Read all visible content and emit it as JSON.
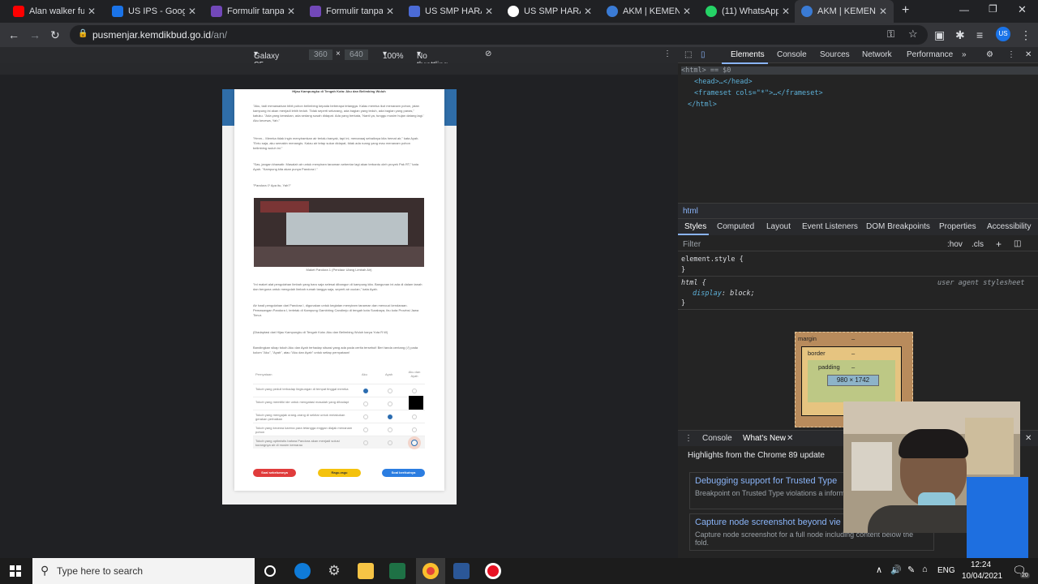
{
  "tabs": [
    {
      "title": "Alan walker full a",
      "color": "#ff0000"
    },
    {
      "title": "US IPS - Google",
      "color": "#1a73e8"
    },
    {
      "title": "Formulir tanpa ju",
      "color": "#7248b9"
    },
    {
      "title": "Formulir tanpa ju",
      "color": "#7248b9"
    },
    {
      "title": "US SMP HARAPA",
      "color": "#4b6bd6"
    },
    {
      "title": "US SMP HARAPA",
      "color": "#ffffff"
    },
    {
      "title": "AKM | KEMENTE",
      "color": "#3a7bd5"
    },
    {
      "title": "(11) WhatsApp",
      "color": "#25d366"
    },
    {
      "title": "AKM | KEMENTE",
      "color": "#3a7bd5"
    }
  ],
  "address": {
    "host": "pusmenjar.kemdikbud.go.id",
    "path": "/an/"
  },
  "device_toolbar": {
    "device": "Galaxy S5",
    "width": "360",
    "height": "640",
    "times": "×",
    "zoom": "100%",
    "throttle": "No throttling"
  },
  "device_page": {
    "title": "Hijau Kampungku di Tengah Kota: Aku dan Belimbing Wuluh",
    "paragraphs": [
      "\"Aku, tadi menawarkan bibit pohon belimbing kepada beberapa tetangga. Kalau mereka ikut menanam pohon, jalan kampung ini akan menjadi lebih teduh. Tidak seperti sekarang, ada bagian yang teduh, ada bagian yang panas,\" katuku. \"Ada yang keraskan, ada sedang susah didapat. Ada yang berkata, 'Nanti ya, tunggu musim hujan datang lagi.' Aku kecewa, Yah.\"",
      "\"Hmm... Mereka tidak ingin menyiramkan air terlalu banyak, tapi ini, menanaaj sebaiknya kita hemat air,\" kata Ayah. \"Entu saja, aku semakin menangis. Kalau air tetap sukar didapat, tidak ada ruang yang mau menanam pohon belimbing wuluh ini.\"",
      "\"Sas, jangan khawatir. Masalah air untuk menyiram tanaman sebentar lagi akan terbantu oleh proyek Pak RT,\" kata Ayah. \"Kampung kita akan punya Pandora I.\"",
      "\"Pandora I? Apa itu, Yah?\""
    ],
    "photo_caption": "Maket Pandora 1 (Pendaur Ulang Limbah Air)",
    "paragraphs2": [
      "\"Ini maket alat pengolahan limbah yang baru saja selesai dibangun di kampung kita. Bangunan ini ada di dalam tanah dan berguna untuk mengolah limbah rumah tangga saja, seperti air cucian,\" kata Ayah.",
      "Air hasil pengolahan dari Pandora I, digunakan untuk kegiatan menyiram tanaman dan mencuci kendaraan. Pemasangan Pandora I, terletak di Kampung Gambiring Candirejo di tengah kota Surabaya, ibu kota Provinsi Jawa Timur.",
      "(Diadaptasi dari Hijau Kampungku di Tengah Kota: Aku dan Belimbing Wuluh karya Yuta R.W)",
      "Bandingkan sikap tokoh Aku dan Ayah terhadap situasi yang ada pada cerita tersebut! Beri tanda centang (√) pada kolom \"Aku\", \"Ayah\", atau \"Aku dan Ayah\" untuk setiap pernyataan!"
    ],
    "table": {
      "headers": [
        "Pernyataan",
        "Aku",
        "Ayah",
        "Aku dan Ayah"
      ],
      "rows": [
        {
          "text": "Tokoh yang peduli terhadap lingkungan di tempat tinggal mereka",
          "sel": 0
        },
        {
          "text": "Tokoh yang memiliki ide untuk mengatasi masalah yang dihadapi",
          "sel": -1
        },
        {
          "text": "Tokoh yang mengajak orang-orang di sekitar untuk melakukan gerakan perbaikan",
          "sel": 1
        },
        {
          "text": "Tokoh yang kecewa karena para tetangga enggan diajak menanam pohon",
          "sel": -1
        },
        {
          "text": "Tokoh yang optimistis bahwa Pandora akan menjadi solusi kurangnya air di musim kemarau",
          "sel": -1
        }
      ]
    },
    "buttons": {
      "prev": "Soal sebelumnya",
      "flag": "Ragu-ragu",
      "next": "Soal berikutnya"
    }
  },
  "devtools": {
    "tabs": [
      "Elements",
      "Console",
      "Sources",
      "Network",
      "Performance"
    ],
    "dom": {
      "line1": "<html> == $0",
      "line2": "<head>…</head>",
      "line3": "<frameset cols=\"*\">…</frameset>",
      "line4": "</html>"
    },
    "breadcrumb": "html",
    "style_tabs": [
      "Styles",
      "Computed",
      "Layout",
      "Event Listeners",
      "DOM Breakpoints",
      "Properties",
      "Accessibility"
    ],
    "filter": "Filter",
    "hov": ":hov",
    "cls": ".cls",
    "element_style": "element.style {",
    "rule_selector": "html {",
    "rule_source": "user agent stylesheet",
    "rule_prop": "display",
    "rule_val": "block;",
    "close_brace": "}",
    "box": {
      "margin": "margin",
      "border": "border",
      "padding": "padding",
      "content": "980 × 1742",
      "dash": "–"
    },
    "drawer_tabs": [
      "Console",
      "What's New"
    ],
    "whatsnew_title": "Highlights from the Chrome 89 update",
    "items": [
      {
        "title": "Debugging support for Trusted Type",
        "desc": "Breakpoint on Trusted Type violations a information in the Issues tab."
      },
      {
        "title": "Capture node screenshot beyond vie",
        "desc": "Capture node screenshot for a full node including content below the fold."
      }
    ]
  },
  "taskbar": {
    "search": "Type here to search",
    "lang": "ENG",
    "time": "12:24",
    "date": "10/04/2021",
    "badge": "20"
  }
}
